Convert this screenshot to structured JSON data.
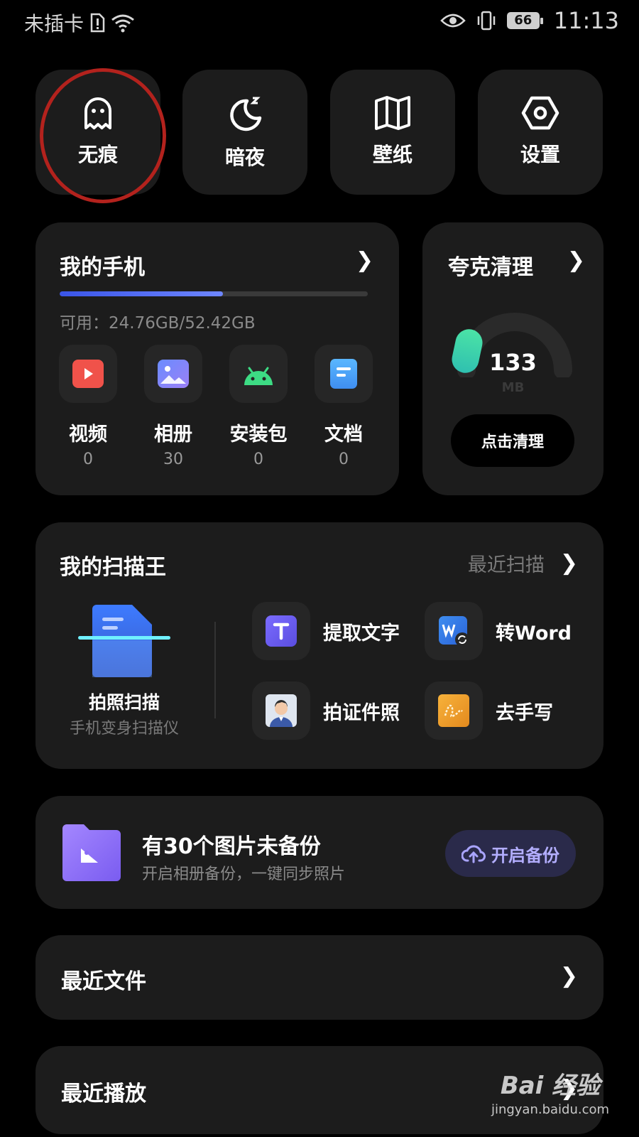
{
  "status_bar": {
    "carrier": "未插卡",
    "battery": "66",
    "time": "11:13"
  },
  "quick_tiles": [
    {
      "label": "无痕",
      "icon": "ghost-icon"
    },
    {
      "label": "暗夜",
      "icon": "moon-icon"
    },
    {
      "label": "壁纸",
      "icon": "wallpaper-icon"
    },
    {
      "label": "设置",
      "icon": "settings-hex-icon"
    }
  ],
  "my_phone": {
    "title": "我的手机",
    "storage_text": "可用：24.76GB/52.42GB",
    "storage_used_fraction": 0.53,
    "categories": [
      {
        "label": "视频",
        "count": "0",
        "icon": "video-icon",
        "color": "#f0524a"
      },
      {
        "label": "相册",
        "count": "30",
        "icon": "album-icon",
        "color": "#7f7bf5"
      },
      {
        "label": "安装包",
        "count": "0",
        "icon": "android-icon",
        "color": "#3ddc84"
      },
      {
        "label": "文档",
        "count": "0",
        "icon": "document-icon",
        "color": "#4aa8f5"
      }
    ]
  },
  "cleaner": {
    "title": "夸克清理",
    "value": "133",
    "unit": "MB",
    "button": "点击清理",
    "accent": "#3ed2a4"
  },
  "scanner": {
    "title": "我的扫描王",
    "recent_link": "最近扫描",
    "main_label": "拍照扫描",
    "main_sub": "手机变身扫描仪",
    "tools": [
      {
        "label": "提取文字",
        "icon": "text-extract-icon"
      },
      {
        "label": "转Word",
        "icon": "word-convert-icon"
      },
      {
        "label": "拍证件照",
        "icon": "id-photo-icon"
      },
      {
        "label": "去手写",
        "icon": "remove-handwriting-icon"
      }
    ]
  },
  "backup": {
    "title": "有30个图片未备份",
    "subtitle": "开启相册备份，一键同步照片",
    "button": "开启备份"
  },
  "recent_files": {
    "title": "最近文件"
  },
  "recent_play": {
    "title": "最近播放"
  },
  "watermark": {
    "brand": "Bai 经验",
    "url": "jingyan.baidu.com"
  }
}
